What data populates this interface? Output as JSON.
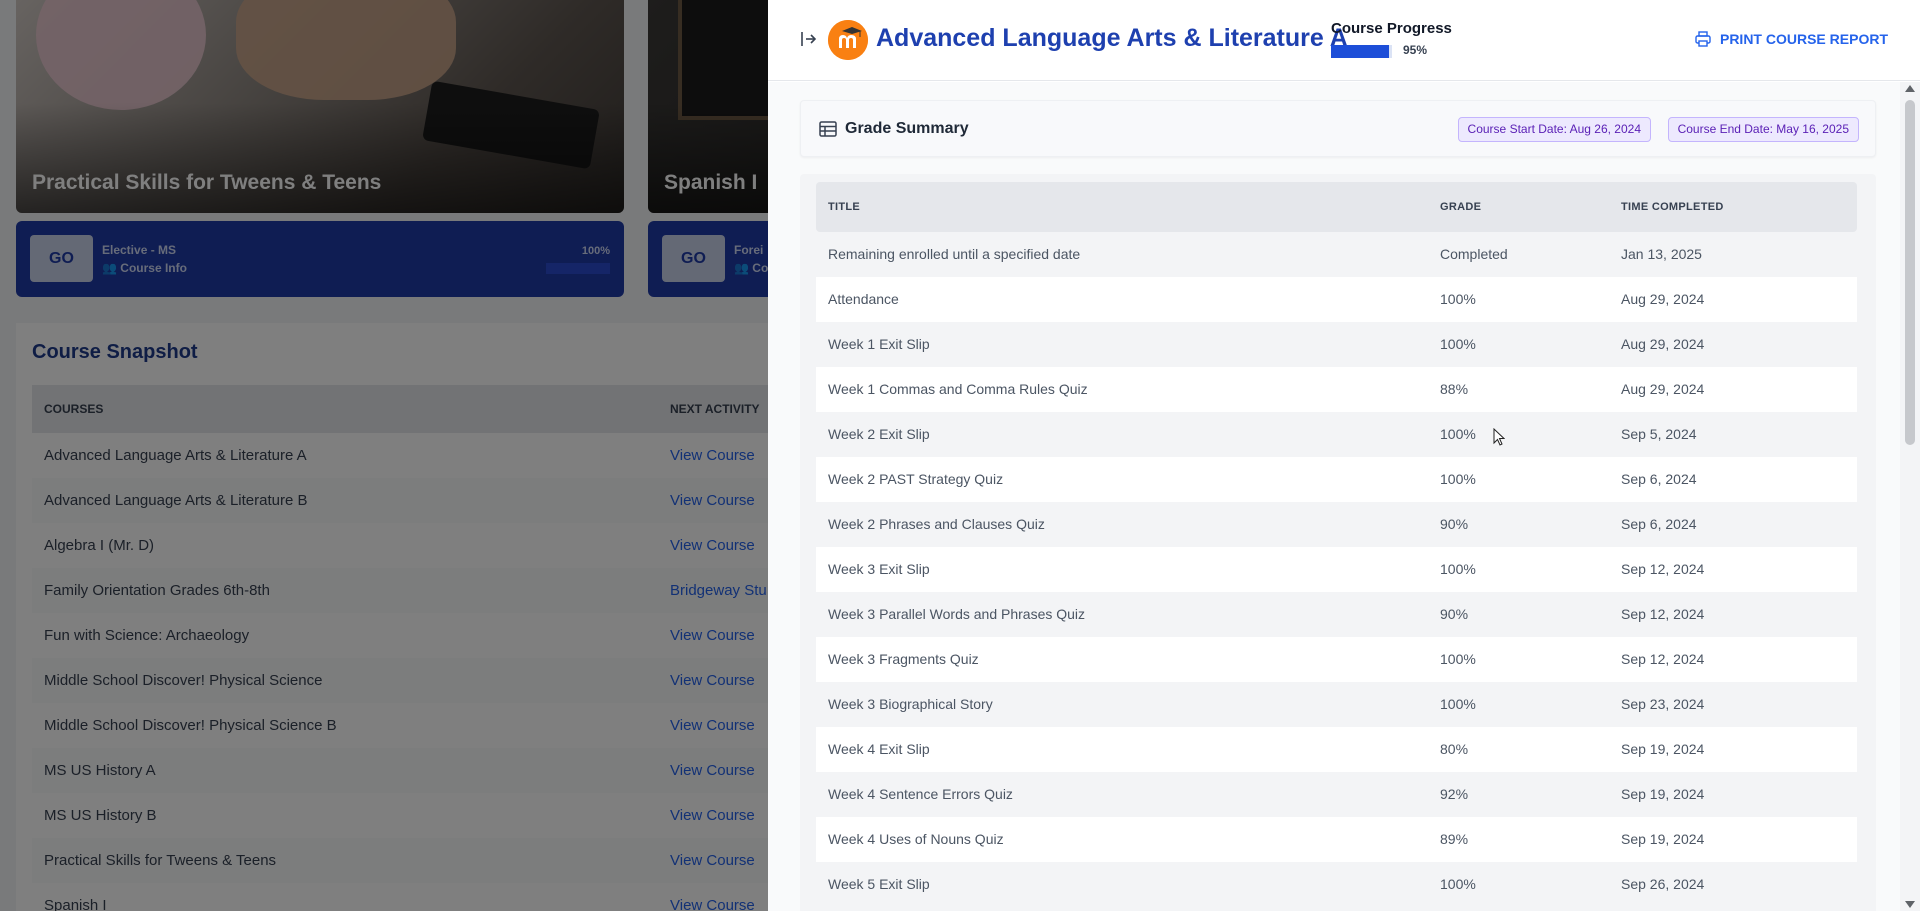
{
  "background": {
    "cards": [
      {
        "title": "Practical Skills for Tweens & Teens",
        "go_label": "GO",
        "category": "Elective - MS",
        "info_label": "Course Info",
        "progress_pct": "100%"
      },
      {
        "title": "Spanish I",
        "go_label": "GO",
        "category": "Forei",
        "info_label": "Co"
      }
    ],
    "snapshot": {
      "title": "Course Snapshot",
      "col_courses": "COURSES",
      "col_next": "NEXT ACTIVITY",
      "rows": [
        {
          "course": "Advanced Language Arts & Literature A",
          "next": "View Course"
        },
        {
          "course": "Advanced Language Arts & Literature B",
          "next": "View Course"
        },
        {
          "course": "Algebra I (Mr. D)",
          "next": "View Course"
        },
        {
          "course": "Family Orientation Grades 6th-8th",
          "next": "Bridgeway Stu"
        },
        {
          "course": "Fun with Science: Archaeology",
          "next": "View Course"
        },
        {
          "course": "Middle School Discover! Physical Science",
          "next": "View Course"
        },
        {
          "course": "Middle School Discover! Physical Science B",
          "next": "View Course"
        },
        {
          "course": "MS US History A",
          "next": "View Course"
        },
        {
          "course": "MS US History B",
          "next": "View Course"
        },
        {
          "course": "Practical Skills for Tweens & Teens",
          "next": "View Course"
        },
        {
          "course": "Spanish I",
          "next": "View Course"
        }
      ]
    }
  },
  "drawer": {
    "title": "Advanced Language Arts & Literature A",
    "progress_label": "Course Progress",
    "progress_value": "95%",
    "progress_fraction": 0.95,
    "print_label": "PRINT COURSE REPORT",
    "summary_title": "Grade Summary",
    "start_date": "Course Start Date: Aug 26, 2024",
    "end_date": "Course End Date: May 16, 2025",
    "columns": {
      "title": "TITLE",
      "grade": "GRADE",
      "time": "TIME COMPLETED"
    },
    "rows": [
      {
        "title": "Remaining enrolled until a specified date",
        "grade": "Completed",
        "time": "Jan 13, 2025"
      },
      {
        "title": "Attendance",
        "grade": "100%",
        "time": "Aug 29, 2024"
      },
      {
        "title": "Week 1 Exit Slip",
        "grade": "100%",
        "time": "Aug 29, 2024"
      },
      {
        "title": "Week 1 Commas and Comma Rules Quiz",
        "grade": "88%",
        "time": "Aug 29, 2024"
      },
      {
        "title": "Week 2 Exit Slip",
        "grade": "100%",
        "time": "Sep 5, 2024"
      },
      {
        "title": "Week 2 PAST Strategy Quiz",
        "grade": "100%",
        "time": "Sep 6, 2024"
      },
      {
        "title": "Week 2 Phrases and Clauses Quiz",
        "grade": "90%",
        "time": "Sep 6, 2024"
      },
      {
        "title": "Week 3 Exit Slip",
        "grade": "100%",
        "time": "Sep 12, 2024"
      },
      {
        "title": "Week 3 Parallel Words and Phrases Quiz",
        "grade": "90%",
        "time": "Sep 12, 2024"
      },
      {
        "title": "Week 3 Fragments Quiz",
        "grade": "100%",
        "time": "Sep 12, 2024"
      },
      {
        "title": "Week 3 Biographical Story",
        "grade": "100%",
        "time": "Sep 23, 2024"
      },
      {
        "title": "Week 4 Exit Slip",
        "grade": "80%",
        "time": "Sep 19, 2024"
      },
      {
        "title": "Week 4 Sentence Errors Quiz",
        "grade": "92%",
        "time": "Sep 19, 2024"
      },
      {
        "title": "Week 4 Uses of Nouns Quiz",
        "grade": "89%",
        "time": "Sep 19, 2024"
      },
      {
        "title": "Week 5 Exit Slip",
        "grade": "100%",
        "time": "Sep 26, 2024"
      }
    ]
  },
  "colors": {
    "accent": "#1e40af",
    "link": "#2563eb",
    "card_bar": "#1f3aa6",
    "badge_bg": "#ede9fe",
    "badge_text": "#5b21b6",
    "logo": "#f98012"
  },
  "icons": [
    "collapse-drawer-icon",
    "moodle-logo-icon",
    "printer-icon",
    "table-icon",
    "users-icon",
    "external-link-icon",
    "mouse-cursor-icon"
  ]
}
